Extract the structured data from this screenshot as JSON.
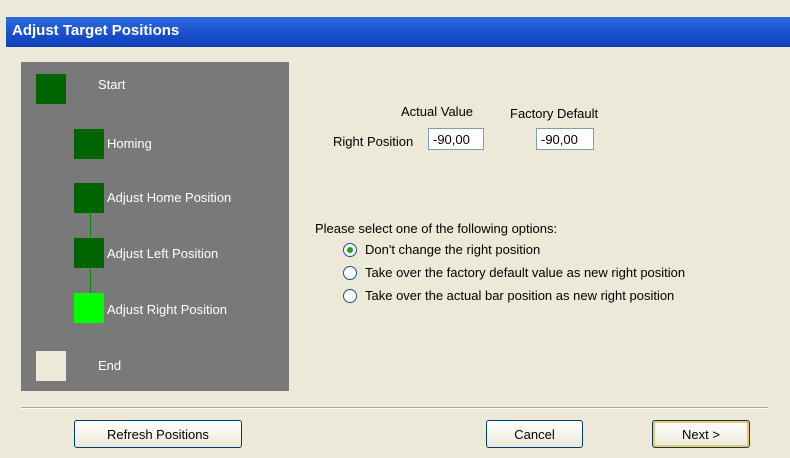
{
  "window": {
    "title": "Adjust Target Positions"
  },
  "steps": [
    {
      "label": "Start",
      "state": "done"
    },
    {
      "label": "Homing",
      "state": "done"
    },
    {
      "label": "Adjust Home Position",
      "state": "done"
    },
    {
      "label": "Adjust Left Position",
      "state": "done"
    },
    {
      "label": "Adjust Right Position",
      "state": "current"
    },
    {
      "label": "End",
      "state": "pending"
    }
  ],
  "positions": {
    "actual_header": "Actual Value",
    "factory_header": "Factory Default",
    "row_label": "Right Position",
    "actual_value": "-90,00",
    "factory_value": "-90,00"
  },
  "options": {
    "prompt": "Please select one of the following options:",
    "items": [
      {
        "label": "Don't change the right position",
        "selected": true
      },
      {
        "label": "Take over the factory default value as new right position",
        "selected": false
      },
      {
        "label": "Take over the actual bar position as new right position",
        "selected": false
      }
    ]
  },
  "buttons": {
    "refresh": "Refresh Positions",
    "cancel": "Cancel",
    "next": "Next >"
  },
  "colors": {
    "step_done": "#006400",
    "step_current": "#00ff00",
    "step_pending": "#ece9d8",
    "title_bar": "#1d55cf"
  }
}
